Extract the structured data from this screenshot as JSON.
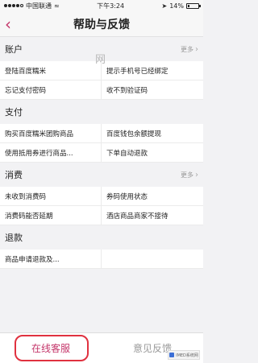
{
  "status_bar": {
    "carrier": "中国联通",
    "wifi": "≈",
    "time": "下午3:24",
    "battery_text": "14%",
    "battery_level": 0.14
  },
  "nav": {
    "back": "‹",
    "title": "帮助与反馈"
  },
  "watermark": "网",
  "sections": [
    {
      "title": "账户",
      "more": "更多",
      "items": [
        "登陆百度糯米",
        "提示手机号已经绑定",
        "忘记支付密码",
        "收不到验证码"
      ]
    },
    {
      "title": "支付",
      "more": "",
      "items": [
        "购买百度糯米团购商品",
        "百度钱包余额提现",
        "使用抵用券进行商品...",
        "下单自动退款"
      ]
    },
    {
      "title": "消费",
      "more": "更多",
      "items": [
        "未收到消费码",
        "券码使用状态",
        "消费码能否延期",
        "酒店商品商家不接待"
      ]
    },
    {
      "title": "退款",
      "more": "",
      "items": [
        "商品申请退款及..."
      ]
    }
  ],
  "bottom": {
    "online_service": "在线客服",
    "feedback": "意见反馈"
  },
  "logo_badge": "IMED系统网",
  "colors": {
    "accent": "#c4366a",
    "highlight": "#e0313f"
  }
}
